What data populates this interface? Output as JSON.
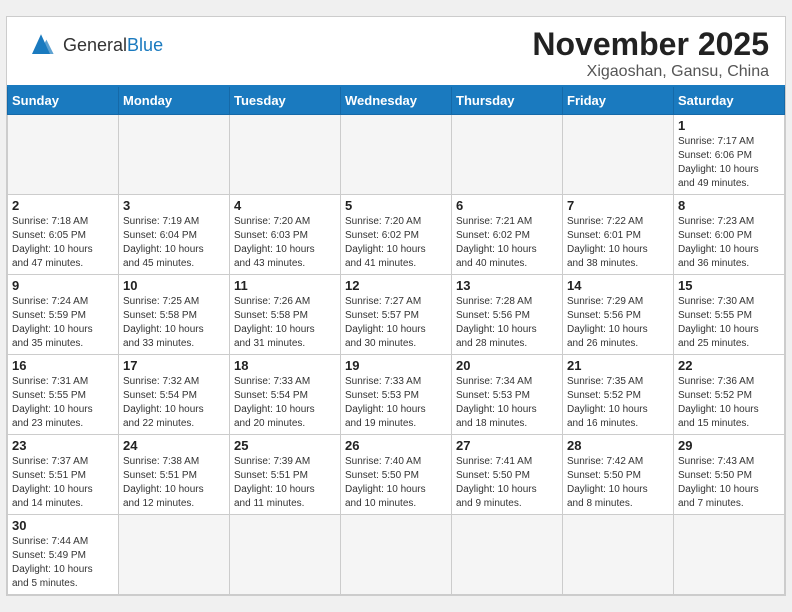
{
  "header": {
    "logo_general": "General",
    "logo_blue": "Blue",
    "month": "November 2025",
    "location": "Xigaoshan, Gansu, China"
  },
  "weekdays": [
    "Sunday",
    "Monday",
    "Tuesday",
    "Wednesday",
    "Thursday",
    "Friday",
    "Saturday"
  ],
  "weeks": [
    [
      {
        "day": "",
        "info": ""
      },
      {
        "day": "",
        "info": ""
      },
      {
        "day": "",
        "info": ""
      },
      {
        "day": "",
        "info": ""
      },
      {
        "day": "",
        "info": ""
      },
      {
        "day": "",
        "info": ""
      },
      {
        "day": "1",
        "info": "Sunrise: 7:17 AM\nSunset: 6:06 PM\nDaylight: 10 hours\nand 49 minutes."
      }
    ],
    [
      {
        "day": "2",
        "info": "Sunrise: 7:18 AM\nSunset: 6:05 PM\nDaylight: 10 hours\nand 47 minutes."
      },
      {
        "day": "3",
        "info": "Sunrise: 7:19 AM\nSunset: 6:04 PM\nDaylight: 10 hours\nand 45 minutes."
      },
      {
        "day": "4",
        "info": "Sunrise: 7:20 AM\nSunset: 6:03 PM\nDaylight: 10 hours\nand 43 minutes."
      },
      {
        "day": "5",
        "info": "Sunrise: 7:20 AM\nSunset: 6:02 PM\nDaylight: 10 hours\nand 41 minutes."
      },
      {
        "day": "6",
        "info": "Sunrise: 7:21 AM\nSunset: 6:02 PM\nDaylight: 10 hours\nand 40 minutes."
      },
      {
        "day": "7",
        "info": "Sunrise: 7:22 AM\nSunset: 6:01 PM\nDaylight: 10 hours\nand 38 minutes."
      },
      {
        "day": "8",
        "info": "Sunrise: 7:23 AM\nSunset: 6:00 PM\nDaylight: 10 hours\nand 36 minutes."
      }
    ],
    [
      {
        "day": "9",
        "info": "Sunrise: 7:24 AM\nSunset: 5:59 PM\nDaylight: 10 hours\nand 35 minutes."
      },
      {
        "day": "10",
        "info": "Sunrise: 7:25 AM\nSunset: 5:58 PM\nDaylight: 10 hours\nand 33 minutes."
      },
      {
        "day": "11",
        "info": "Sunrise: 7:26 AM\nSunset: 5:58 PM\nDaylight: 10 hours\nand 31 minutes."
      },
      {
        "day": "12",
        "info": "Sunrise: 7:27 AM\nSunset: 5:57 PM\nDaylight: 10 hours\nand 30 minutes."
      },
      {
        "day": "13",
        "info": "Sunrise: 7:28 AM\nSunset: 5:56 PM\nDaylight: 10 hours\nand 28 minutes."
      },
      {
        "day": "14",
        "info": "Sunrise: 7:29 AM\nSunset: 5:56 PM\nDaylight: 10 hours\nand 26 minutes."
      },
      {
        "day": "15",
        "info": "Sunrise: 7:30 AM\nSunset: 5:55 PM\nDaylight: 10 hours\nand 25 minutes."
      }
    ],
    [
      {
        "day": "16",
        "info": "Sunrise: 7:31 AM\nSunset: 5:55 PM\nDaylight: 10 hours\nand 23 minutes."
      },
      {
        "day": "17",
        "info": "Sunrise: 7:32 AM\nSunset: 5:54 PM\nDaylight: 10 hours\nand 22 minutes."
      },
      {
        "day": "18",
        "info": "Sunrise: 7:33 AM\nSunset: 5:54 PM\nDaylight: 10 hours\nand 20 minutes."
      },
      {
        "day": "19",
        "info": "Sunrise: 7:33 AM\nSunset: 5:53 PM\nDaylight: 10 hours\nand 19 minutes."
      },
      {
        "day": "20",
        "info": "Sunrise: 7:34 AM\nSunset: 5:53 PM\nDaylight: 10 hours\nand 18 minutes."
      },
      {
        "day": "21",
        "info": "Sunrise: 7:35 AM\nSunset: 5:52 PM\nDaylight: 10 hours\nand 16 minutes."
      },
      {
        "day": "22",
        "info": "Sunrise: 7:36 AM\nSunset: 5:52 PM\nDaylight: 10 hours\nand 15 minutes."
      }
    ],
    [
      {
        "day": "23",
        "info": "Sunrise: 7:37 AM\nSunset: 5:51 PM\nDaylight: 10 hours\nand 14 minutes."
      },
      {
        "day": "24",
        "info": "Sunrise: 7:38 AM\nSunset: 5:51 PM\nDaylight: 10 hours\nand 12 minutes."
      },
      {
        "day": "25",
        "info": "Sunrise: 7:39 AM\nSunset: 5:51 PM\nDaylight: 10 hours\nand 11 minutes."
      },
      {
        "day": "26",
        "info": "Sunrise: 7:40 AM\nSunset: 5:50 PM\nDaylight: 10 hours\nand 10 minutes."
      },
      {
        "day": "27",
        "info": "Sunrise: 7:41 AM\nSunset: 5:50 PM\nDaylight: 10 hours\nand 9 minutes."
      },
      {
        "day": "28",
        "info": "Sunrise: 7:42 AM\nSunset: 5:50 PM\nDaylight: 10 hours\nand 8 minutes."
      },
      {
        "day": "29",
        "info": "Sunrise: 7:43 AM\nSunset: 5:50 PM\nDaylight: 10 hours\nand 7 minutes."
      }
    ],
    [
      {
        "day": "30",
        "info": "Sunrise: 7:44 AM\nSunset: 5:49 PM\nDaylight: 10 hours\nand 5 minutes."
      },
      {
        "day": "",
        "info": ""
      },
      {
        "day": "",
        "info": ""
      },
      {
        "day": "",
        "info": ""
      },
      {
        "day": "",
        "info": ""
      },
      {
        "day": "",
        "info": ""
      },
      {
        "day": "",
        "info": ""
      }
    ]
  ]
}
